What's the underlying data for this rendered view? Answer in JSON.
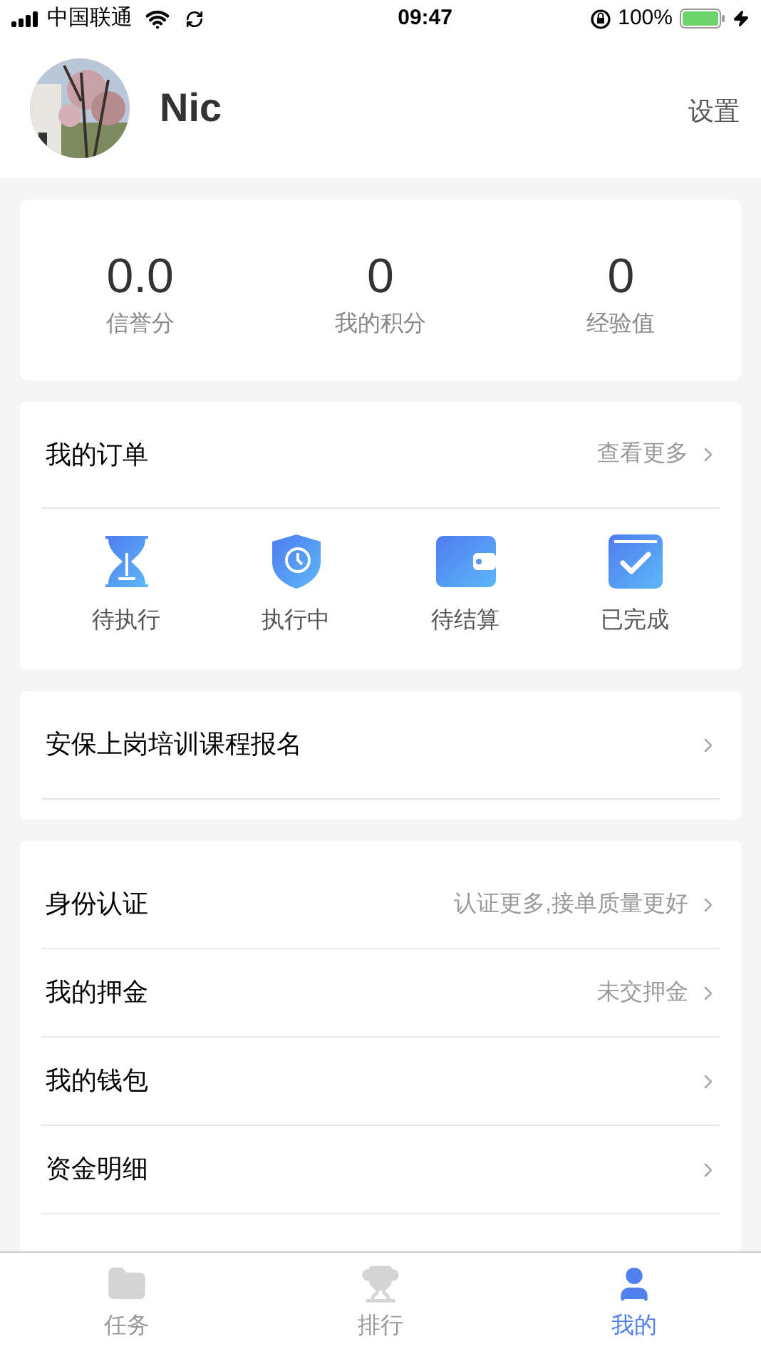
{
  "status_bar": {
    "carrier": "中国联通",
    "time": "09:47",
    "battery": "100%"
  },
  "profile": {
    "name": "Nic",
    "settings": "设置"
  },
  "stats": [
    {
      "value": "0.0",
      "label": "信誉分"
    },
    {
      "value": "0",
      "label": "我的积分"
    },
    {
      "value": "0",
      "label": "经验值"
    }
  ],
  "orders": {
    "title": "我的订单",
    "more": "查看更多",
    "items": [
      {
        "kind": "pending",
        "label": "待执行"
      },
      {
        "kind": "running",
        "label": "执行中"
      },
      {
        "kind": "settle",
        "label": "待结算"
      },
      {
        "kind": "done",
        "label": "已完成"
      }
    ]
  },
  "training": {
    "title": "安保上岗培训课程报名"
  },
  "menu": [
    {
      "label": "身份认证",
      "hint": "认证更多,接单质量更好"
    },
    {
      "label": "我的押金",
      "hint": "未交押金"
    },
    {
      "label": "我的钱包"
    },
    {
      "label": "资金明细"
    }
  ],
  "tab_bar": [
    {
      "kind": "task",
      "label": "任务",
      "selected": false
    },
    {
      "kind": "rank",
      "label": "排行",
      "selected": false
    },
    {
      "kind": "me",
      "label": "我的",
      "selected": true
    }
  ]
}
